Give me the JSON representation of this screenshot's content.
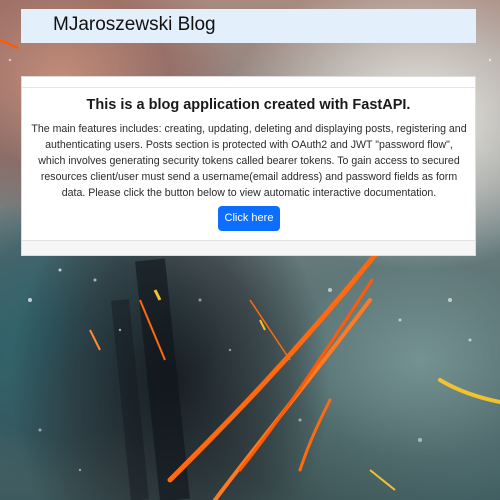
{
  "navbar": {
    "brand": "MJaroszewski Blog"
  },
  "card": {
    "title": "This is a blog application created with FastAPI.",
    "text": "The main features includes: creating, updating, deleting and displaying posts, registering and authenticating users. Posts section is protected with OAuth2 and JWT \"password flow\", which involves generating security tokens called bearer tokens. To gain access to secured resources client/user must send a username(email address) and password fields as form data. Please click the button below to view automatic interactive documentation.",
    "button_label": "Click here"
  },
  "colors": {
    "navbar_bg": "#e3f0fb",
    "button_bg": "#0d6efd",
    "button_text": "#ffffff",
    "paint_accent": "#ff6a10"
  }
}
